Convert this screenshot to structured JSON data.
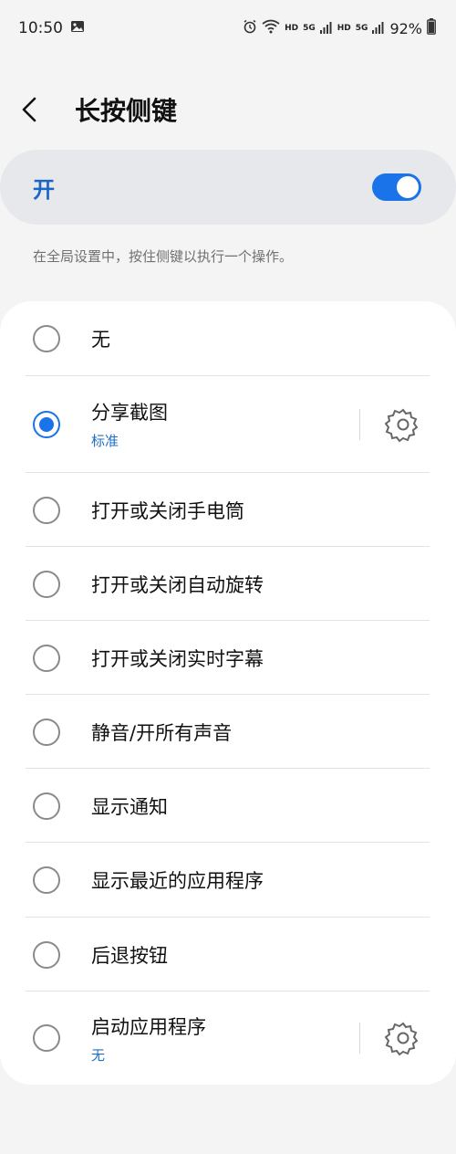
{
  "status_bar": {
    "time": "10:50",
    "battery": "92%",
    "hd1": "HD",
    "hd2": "HD",
    "net1": "5G",
    "net2": "5G",
    "icons": [
      "gallery-icon",
      "alarm-icon",
      "wifi-icon",
      "signal-icon",
      "battery-icon"
    ]
  },
  "header": {
    "title": "长按侧键"
  },
  "master_switch": {
    "label": "开",
    "state": "on",
    "accent": "#1a73e8"
  },
  "description": "在全局设置中，按住侧键以执行一个操作。",
  "options": [
    {
      "label": "无",
      "selected": false
    },
    {
      "label": "分享截图",
      "sub": "标准",
      "selected": true,
      "settings": true
    },
    {
      "label": "打开或关闭手电筒",
      "selected": false
    },
    {
      "label": "打开或关闭自动旋转",
      "selected": false
    },
    {
      "label": "打开或关闭实时字幕",
      "selected": false
    },
    {
      "label": "静音/开所有声音",
      "selected": false
    },
    {
      "label": "显示通知",
      "selected": false
    },
    {
      "label": "显示最近的应用程序",
      "selected": false
    },
    {
      "label": "后退按钮",
      "selected": false
    },
    {
      "label": "启动应用程序",
      "sub": "无",
      "selected": false,
      "settings": true
    }
  ]
}
